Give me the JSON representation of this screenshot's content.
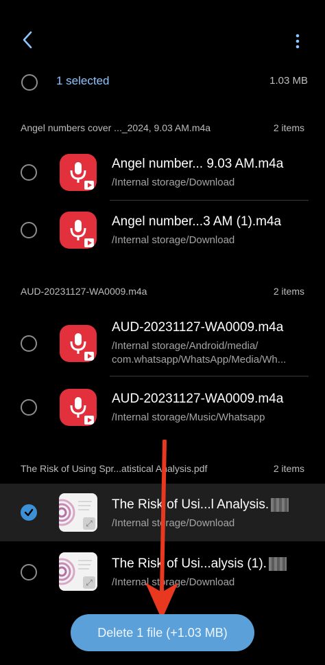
{
  "header": {
    "back_icon": "chevron-left-icon",
    "more_icon": "more-vertical-icon"
  },
  "selection": {
    "label": "1 selected",
    "size": "1.03 MB"
  },
  "groups": [
    {
      "title": "Angel numbers cover ..._2024, 9.03 AM.m4a",
      "count": "2 items",
      "items": [
        {
          "name": "Angel number... 9.03 AM.m4a",
          "path": "/Internal storage/Download",
          "checked": false
        },
        {
          "name": "Angel number...3 AM (1).m4a",
          "path": "/Internal storage/Download",
          "checked": false
        }
      ]
    },
    {
      "title": "AUD-20231127-WA0009.m4a",
      "count": "2 items",
      "items": [
        {
          "name": "AUD-20231127-WA0009.m4a",
          "path_line1": "/Internal storage/Android/media/",
          "path_line2": "com.whatsapp/WhatsApp/Media/Wh...",
          "checked": false
        },
        {
          "name": "AUD-20231127-WA0009.m4a",
          "path": "/Internal storage/Music/Whatsapp",
          "checked": false
        }
      ]
    },
    {
      "title": "The Risk of Using Spr...atistical Analysis.pdf",
      "count": "2 items",
      "items": [
        {
          "name": "The Risk of Usi...l Analysis.",
          "path": "/Internal storage/Download",
          "checked": true
        },
        {
          "name": "The Risk of Usi...alysis (1).",
          "path": "/Internal storage/Download",
          "checked": false
        }
      ]
    }
  ],
  "delete_button": {
    "label": "Delete 1 file (+1.03 MB)"
  },
  "colors": {
    "accent": "#5ba0d8",
    "selected_text": "#8ec4ff",
    "audio_icon_bg": "#e2303c",
    "annotation_arrow": "#e8381f"
  }
}
